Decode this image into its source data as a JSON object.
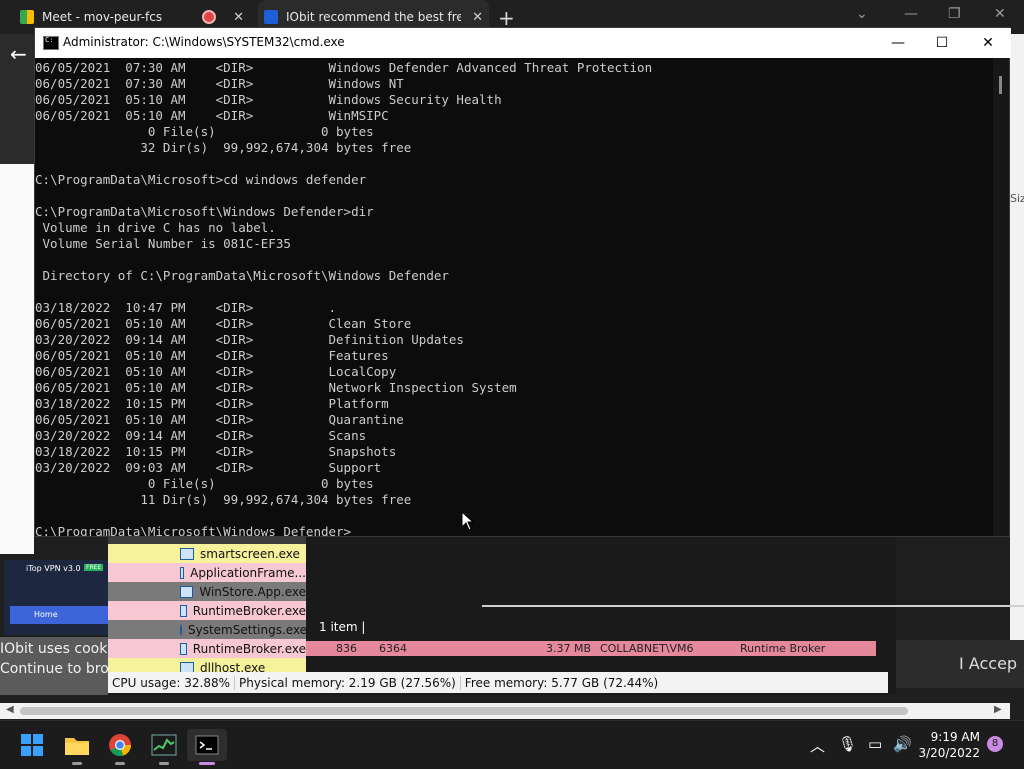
{
  "browser": {
    "tabs": [
      {
        "title": "Meet - mov-peur-fcs"
      },
      {
        "title": "IObit recommend the best free, f"
      }
    ],
    "new_tab": "+",
    "back": "←",
    "right_fragment": "Size"
  },
  "cmd": {
    "title": "Administrator: C:\\Windows\\SYSTEM32\\cmd.exe",
    "lines": [
      "06/05/2021  07:30 AM    <DIR>          Windows Defender Advanced Threat Protection",
      "06/05/2021  07:30 AM    <DIR>          Windows NT",
      "06/05/2021  05:10 AM    <DIR>          Windows Security Health",
      "06/05/2021  05:10 AM    <DIR>          WinMSIPC",
      "               0 File(s)              0 bytes",
      "              32 Dir(s)  99,992,674,304 bytes free",
      "",
      "C:\\ProgramData\\Microsoft>cd windows defender",
      "",
      "C:\\ProgramData\\Microsoft\\Windows Defender>dir",
      " Volume in drive C has no label.",
      " Volume Serial Number is 081C-EF35",
      "",
      " Directory of C:\\ProgramData\\Microsoft\\Windows Defender",
      "",
      "03/18/2022  10:47 PM    <DIR>          .",
      "06/05/2021  05:10 AM    <DIR>          Clean Store",
      "03/20/2022  09:14 AM    <DIR>          Definition Updates",
      "06/05/2021  05:10 AM    <DIR>          Features",
      "06/05/2021  05:10 AM    <DIR>          LocalCopy",
      "06/05/2021  05:10 AM    <DIR>          Network Inspection System",
      "03/18/2022  10:15 PM    <DIR>          Platform",
      "06/05/2021  05:10 AM    <DIR>          Quarantine",
      "03/20/2022  09:14 AM    <DIR>          Scans",
      "03/18/2022  10:15 PM    <DIR>          Snapshots",
      "03/20/2022  09:03 AM    <DIR>          Support",
      "               0 File(s)              0 bytes",
      "              11 Dir(s)  99,992,674,304 bytes free",
      "",
      "C:\\ProgramData\\Microsoft\\Windows Defender>"
    ]
  },
  "task_manager": {
    "processes": [
      {
        "name": "smartscreen.exe",
        "color": "yellow"
      },
      {
        "name": "ApplicationFrame...",
        "color": "pink"
      },
      {
        "name": "WinStore.App.exe",
        "color": "gray"
      },
      {
        "name": "RuntimeBroker.exe",
        "color": "pink"
      },
      {
        "name": "SystemSettings.exe",
        "color": "gray"
      },
      {
        "name": "RuntimeBroker.exe",
        "color": "pink"
      },
      {
        "name": "dllhost.exe",
        "color": "yellow"
      }
    ],
    "items_count": "1 item",
    "detail_row": {
      "pid": "836",
      "mem_id": "6364",
      "memory": "3.37 MB",
      "user": "COLLABNET\\VM6",
      "desc": "Runtime Broker"
    },
    "status": {
      "cpu": "CPU usage: 32.88%",
      "physical": "Physical memory: 2.19 GB (27.56%)",
      "free": "Free memory: 5.77 GB (72.44%)"
    }
  },
  "overlay": {
    "vpn_title": "iTop VPN v3.0",
    "vpn_badge": "FREE",
    "vpn_home": "Home",
    "cookie_line1": "IObit uses cookie",
    "cookie_line2": "Continue to brow",
    "accept": "I Accep"
  },
  "taskbar": {
    "apps": [
      "start-icon",
      "file-explorer-icon",
      "chrome-icon",
      "task-manager-icon",
      "terminal-icon"
    ],
    "time": "9:19 AM",
    "date": "3/20/2022",
    "notifications": "8"
  },
  "colors": {
    "cmd_bg": "#0c0c0c",
    "cmd_text": "#cccccc",
    "accent": "#c88be0"
  }
}
